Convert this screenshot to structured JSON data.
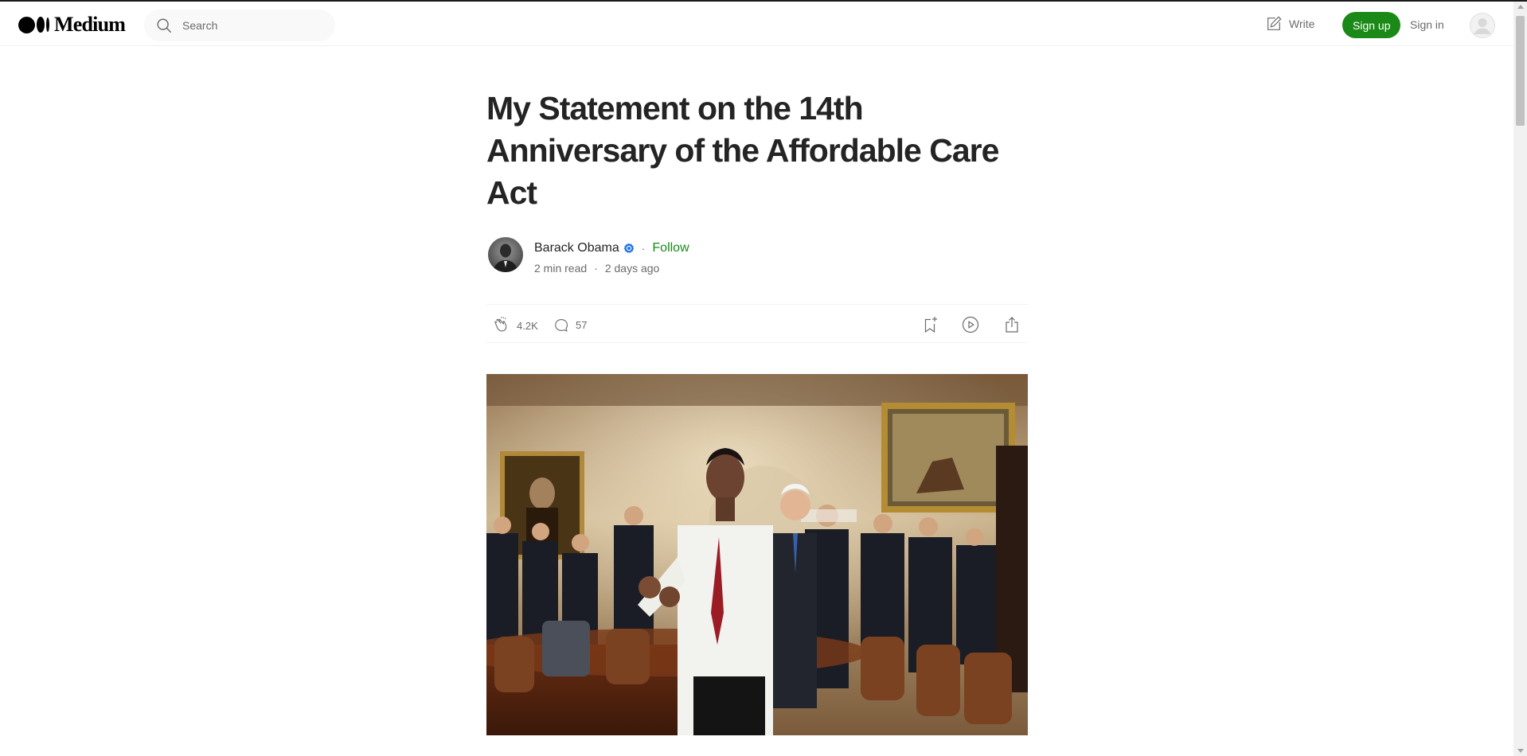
{
  "header": {
    "logo_text": "Medium",
    "search_placeholder": "Search",
    "write_label": "Write",
    "signup_label": "Sign up",
    "signin_label": "Sign in"
  },
  "article": {
    "title": "My Statement on the 14th Anniversary of the Affordable Care Act",
    "author": {
      "name": "Barack Obama",
      "verified": true,
      "follow_label": "Follow"
    },
    "meta": {
      "read_time": "2 min read",
      "separator": "·",
      "published": "2 days ago"
    },
    "stats": {
      "claps": "4.2K",
      "comments": "57"
    }
  },
  "colors": {
    "brand_green": "#1a8917",
    "text_primary": "#242424",
    "text_secondary": "#6b6b6b",
    "verified_blue": "#1a73e8"
  },
  "icons": [
    "search-icon",
    "write-icon",
    "user-avatar-icon",
    "verified-badge-icon",
    "clap-icon",
    "comment-icon",
    "bookmark-add-icon",
    "play-listen-icon",
    "share-icon"
  ]
}
